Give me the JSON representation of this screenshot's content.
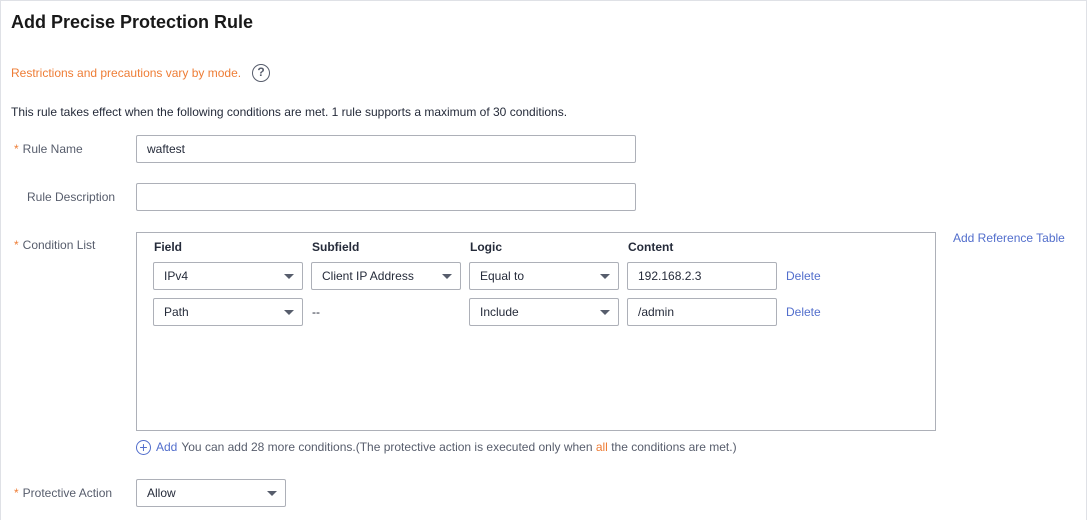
{
  "title": "Add Precise Protection Rule",
  "notice": "Restrictions and precautions vary by mode.",
  "help_icon": "?",
  "intro": "This rule takes effect when the following conditions are met. 1 rule supports a maximum of 30 conditions.",
  "required_mark": "*",
  "rule_name": {
    "label": "Rule Name",
    "value": "waftest"
  },
  "rule_description": {
    "label": "Rule Description",
    "value": ""
  },
  "condition_list": {
    "label": "Condition List",
    "add_reference_table": "Add Reference Table",
    "columns": {
      "field": "Field",
      "subfield": "Subfield",
      "logic": "Logic",
      "content": "Content"
    },
    "rows": [
      {
        "field": "IPv4",
        "subfield": "Client IP Address",
        "logic": "Equal to",
        "content": "192.168.2.3",
        "delete": "Delete"
      },
      {
        "field": "Path",
        "subfield": "--",
        "logic": "Include",
        "content": "/admin",
        "delete": "Delete"
      }
    ],
    "add_label": "Add",
    "add_hint_before": "You can add 28 more conditions.(The protective action is executed only when",
    "add_hint_highlight": "all",
    "add_hint_after": "the conditions are met.)"
  },
  "protective_action": {
    "label": "Protective Action",
    "value": "Allow"
  },
  "icons": {
    "help": "question-circle-icon",
    "add": "plus-circle-icon",
    "dropdown": "chevron-down-icon"
  },
  "colors": {
    "accent": "#526ecc",
    "warning": "#ee7d36",
    "border": "#adb0b8"
  }
}
